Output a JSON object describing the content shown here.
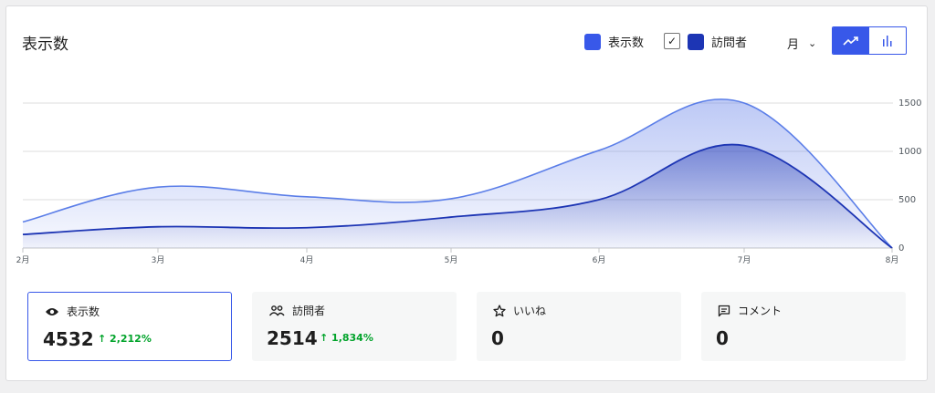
{
  "title": "表示数",
  "legend": [
    {
      "label": "表示数",
      "color": "#3858e9"
    },
    {
      "label": "訪問者",
      "color": "#1d35b4"
    }
  ],
  "period": {
    "label": "月"
  },
  "colors": {
    "accent": "#3858e9",
    "views_line": "#5b7ee8",
    "visitors_line": "#1d35b4",
    "positive": "#00a32a"
  },
  "chart_data": {
    "type": "area",
    "categories": [
      "2月",
      "3月",
      "4月",
      "5月",
      "6月",
      "7月",
      "8月"
    ],
    "series": [
      {
        "name": "表示数",
        "values": [
          270,
          630,
          530,
          510,
          1010,
          1500,
          0
        ]
      },
      {
        "name": "訪問者",
        "values": [
          140,
          220,
          210,
          320,
          500,
          1060,
          0
        ]
      }
    ],
    "y_ticks": [
      "1500",
      "1000",
      "500",
      "0"
    ],
    "ylim": [
      0,
      1500
    ],
    "grid": true,
    "legend_position": "top-right"
  },
  "cards": [
    {
      "label": "表示数",
      "icon": "eye-icon",
      "value": "4532",
      "delta": "↑ 2,212%"
    },
    {
      "label": "訪問者",
      "icon": "people-icon",
      "value": "2514",
      "delta": "↑ 1,834%"
    },
    {
      "label": "いいね",
      "icon": "star-icon",
      "value": "0",
      "delta": ""
    },
    {
      "label": "コメント",
      "icon": "comment-icon",
      "value": "0",
      "delta": ""
    }
  ]
}
